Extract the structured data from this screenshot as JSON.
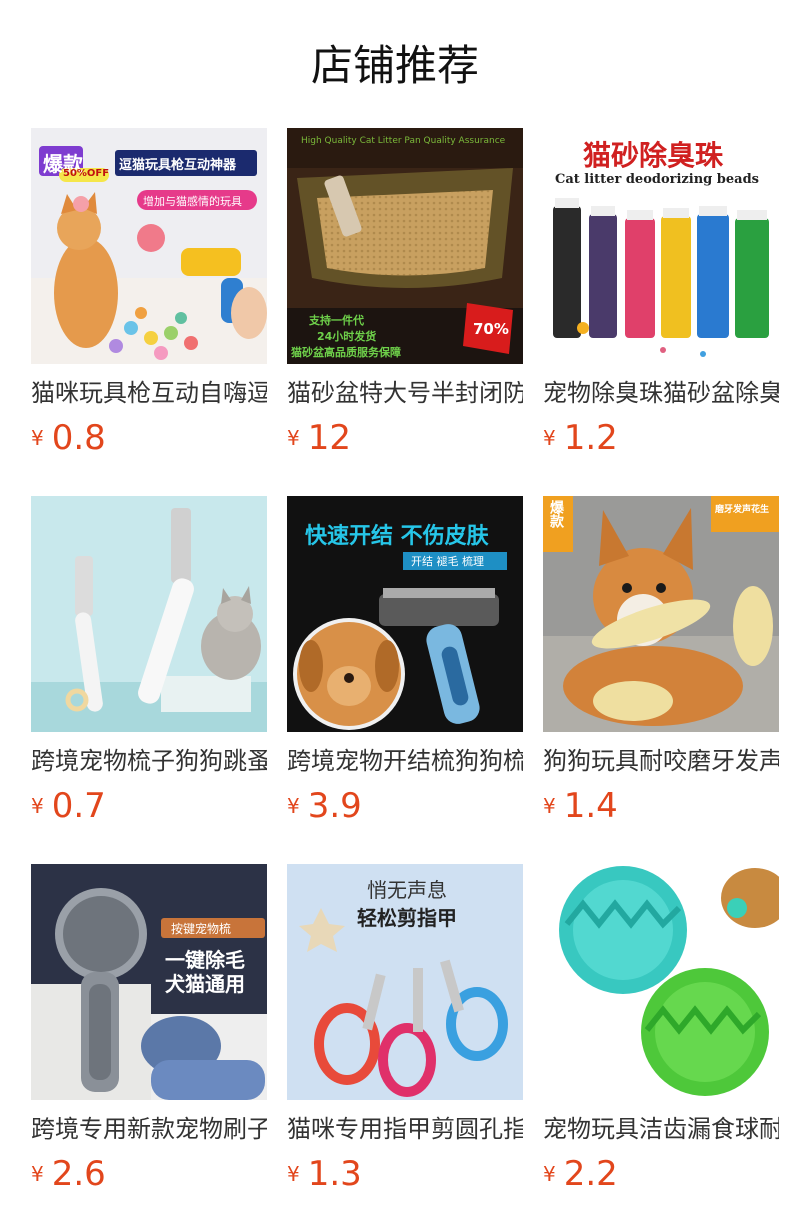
{
  "page_title": "店铺推荐",
  "currency": "¥",
  "products": [
    {
      "name": "猫咪玩具枪互动自嗨逗猫",
      "price": "0.8",
      "badge": "爆款",
      "headline": "逗猫玩具枪互动神器",
      "sub": "增加与猫感情的玩具",
      "tag": "50%OFF"
    },
    {
      "name": "猫砂盆特大号半封闭防外",
      "price": "12",
      "headline": "High Quality Cat Litter Pan Quality Assurance",
      "lines": [
        "支持一件代",
        "24小时发货",
        "猫砂盆高品质服务保障"
      ],
      "tag": "70%"
    },
    {
      "name": "宠物除臭珠猫砂盆除臭",
      "price": "1.2",
      "headline": "猫砂除臭珠",
      "sub": "Cat litter deodorizing beads"
    },
    {
      "name": "跨境宠物梳子狗狗跳蚤梳",
      "price": "0.7"
    },
    {
      "name": "跨境宠物开结梳狗狗梳子",
      "price": "3.9",
      "headline": "快速开结 不伤皮肤",
      "sub": "开结 褪毛 梳理"
    },
    {
      "name": "狗狗玩具耐咬磨牙发声",
      "price": "1.4",
      "badge": "爆款",
      "tag": "磨牙发声花生"
    },
    {
      "name": "跨境专用新款宠物刷子",
      "price": "2.6",
      "tag": "按键宠物梳",
      "headline": "一键除毛",
      "sub": "犬猫通用"
    },
    {
      "name": "猫咪专用指甲剪圆孔指甲",
      "price": "1.3",
      "headline": "悄无声息",
      "sub": "轻松剪指甲"
    },
    {
      "name": "宠物玩具洁齿漏食球耐咬",
      "price": "2.2"
    }
  ]
}
